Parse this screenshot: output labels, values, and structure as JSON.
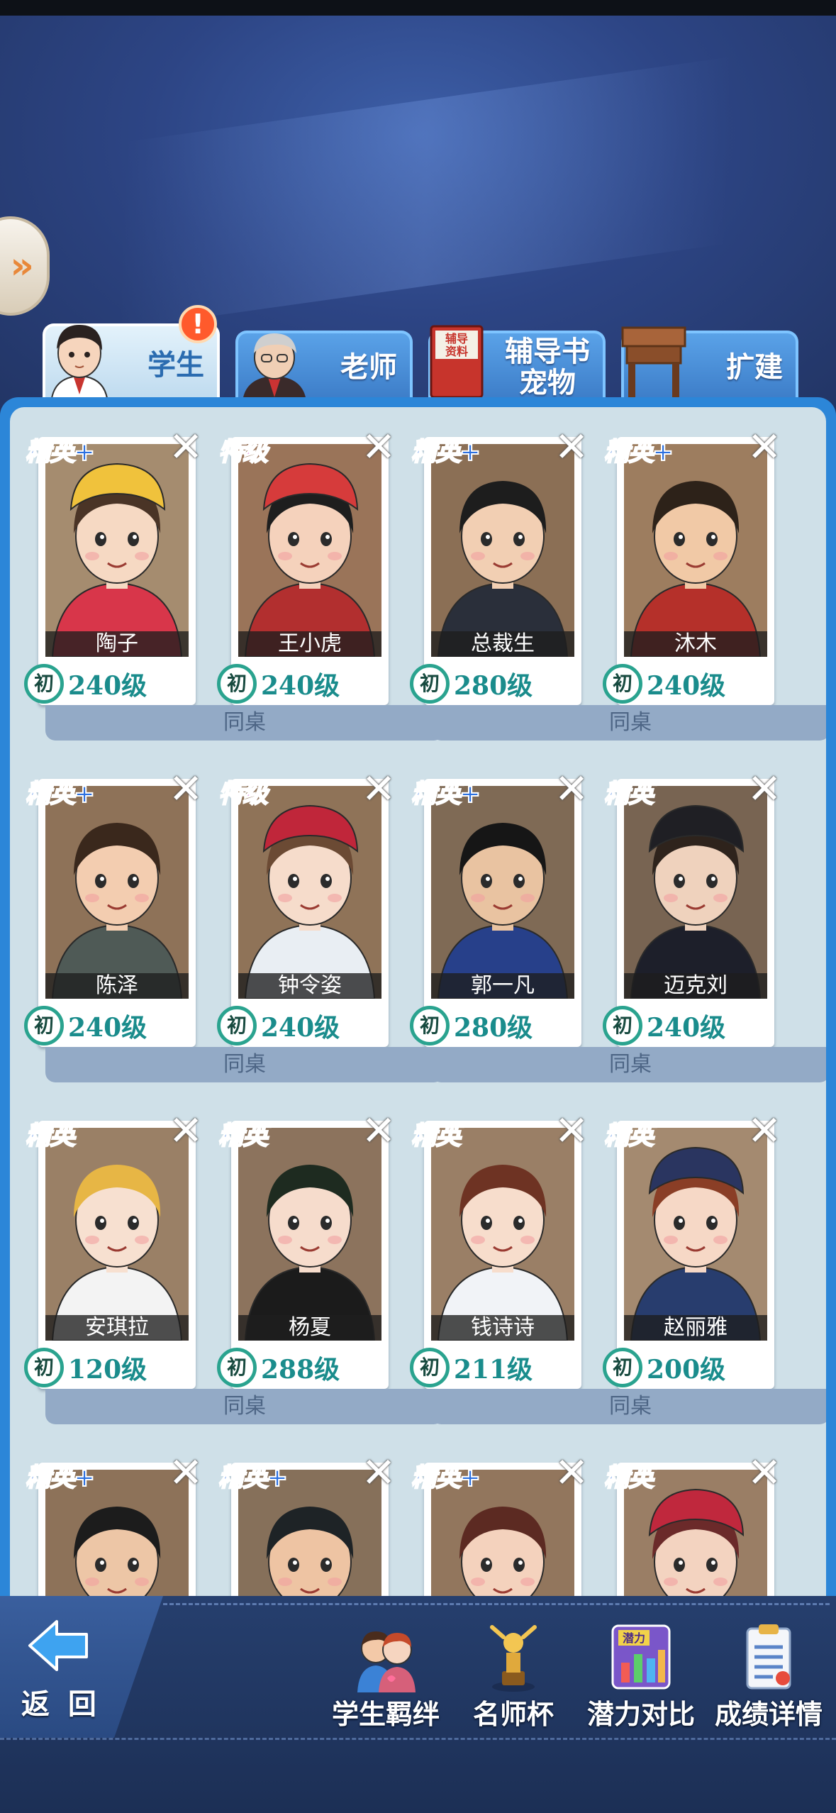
{
  "side_button": {
    "glyph": "»"
  },
  "tabs": [
    {
      "label": "学生",
      "label2": "",
      "active": true,
      "badge": "!"
    },
    {
      "label": "老师",
      "label2": "",
      "active": false
    },
    {
      "label": "辅导书",
      "label2": "宠物",
      "active": false,
      "book_text": "辅导\n资料"
    },
    {
      "label": "扩建",
      "label2": "",
      "active": false
    }
  ],
  "book_text": "辅导资料",
  "cards": [
    {
      "rank": "精英+",
      "rank_type": "elite",
      "name": "陶子",
      "stage": "初",
      "level": "240级",
      "bg": "#a58c6f",
      "skin": "#f6d9c3",
      "hair": "#4a3426",
      "hat": "#f0c23c",
      "shirt": "#d8364a"
    },
    {
      "rank": "特级",
      "rank_type": "special",
      "name": "王小虎",
      "stage": "初",
      "level": "240级",
      "bg": "#9a7459",
      "skin": "#f5d2bc",
      "hair": "#1e1e1e",
      "hat": "#d63b3b",
      "shirt": "#b22f2f"
    },
    {
      "rank": "精英+",
      "rank_type": "elite",
      "name": "总裁生",
      "stage": "初",
      "level": "280级",
      "bg": "#8b6f55",
      "skin": "#f2cfb3",
      "hair": "#1d1d1d",
      "hat": "",
      "shirt": "#2a2f3a"
    },
    {
      "rank": "精英+",
      "rank_type": "elite",
      "name": "沐木",
      "stage": "初",
      "level": "240级",
      "bg": "#9d7d5f",
      "skin": "#f1c9a6",
      "hair": "#2d2219",
      "hat": "",
      "shirt": "#b5302a"
    },
    {
      "rank": "精英+",
      "rank_type": "elite",
      "name": "陈泽",
      "stage": "初",
      "level": "240级",
      "bg": "#8e7258",
      "skin": "#f3cdb0",
      "hair": "#3a281c",
      "hat": "",
      "shirt": "#4f5a56"
    },
    {
      "rank": "特级",
      "rank_type": "special",
      "name": "钟令姿",
      "stage": "初",
      "level": "240级",
      "bg": "#8f7358",
      "skin": "#f6dccb",
      "hair": "#6b4a34",
      "hat": "#c0263a",
      "shirt": "#e9eef3"
    },
    {
      "rank": "精英+",
      "rank_type": "elite",
      "name": "郭一凡",
      "stage": "初",
      "level": "280级",
      "bg": "#7f6a55",
      "skin": "#e9c3a1",
      "hair": "#161616",
      "hat": "",
      "shirt": "#27408a"
    },
    {
      "rank": "精英",
      "rank_type": "elite",
      "name": "迈克刘",
      "stage": "初",
      "level": "240级",
      "bg": "#786452",
      "skin": "#efd2bd",
      "hair": "#2e231c",
      "hat": "#1f1f24",
      "shirt": "#1d1f2a"
    },
    {
      "rank": "精英",
      "rank_type": "elite",
      "name": "安琪拉",
      "stage": "初",
      "level": "120级",
      "bg": "#9a8066",
      "skin": "#f7e0d0",
      "hair": "#e7b645",
      "hat": "",
      "shirt": "#f3f3f3"
    },
    {
      "rank": "精英",
      "rank_type": "elite",
      "name": "杨夏",
      "stage": "初",
      "level": "288级",
      "bg": "#8c735d",
      "skin": "#f6dccc",
      "hair": "#1e2b20",
      "hat": "",
      "shirt": "#1b1b1b"
    },
    {
      "rank": "精英",
      "rank_type": "elite",
      "name": "钱诗诗",
      "stage": "初",
      "level": "211级",
      "bg": "#9a7f66",
      "skin": "#f7ddcc",
      "hair": "#6e3323",
      "hat": "",
      "shirt": "#f1f3f7"
    },
    {
      "rank": "精英",
      "rank_type": "elite",
      "name": "赵丽雅",
      "stage": "初",
      "level": "200级",
      "bg": "#a48a70",
      "skin": "#f6d8c6",
      "hair": "#8a3e26",
      "hat": "#2a3560",
      "shirt": "#283d6e"
    },
    {
      "rank": "精英+",
      "rank_type": "elite",
      "name": "",
      "stage": "",
      "level": "",
      "bg": "#8d7259",
      "skin": "#edc6a6",
      "hair": "#1c1c1c",
      "hat": "",
      "shirt": "#3a3a3a"
    },
    {
      "rank": "精英+",
      "rank_type": "elite",
      "name": "",
      "stage": "",
      "level": "",
      "bg": "#86705a",
      "skin": "#eec4a3",
      "hair": "#1e2326",
      "hat": "",
      "shirt": "#3a3a3a"
    },
    {
      "rank": "精英+",
      "rank_type": "elite",
      "name": "",
      "stage": "",
      "level": "",
      "bg": "#92765d",
      "skin": "#f4d2bd",
      "hair": "#5c2a22",
      "hat": "",
      "shirt": "#3a3a3a"
    },
    {
      "rank": "精英",
      "rank_type": "elite",
      "name": "",
      "stage": "",
      "level": "",
      "bg": "#9a7e65",
      "skin": "#f3d3c0",
      "hair": "#6b2a2a",
      "hat": "#c0283d",
      "shirt": "#3a3a3a"
    }
  ],
  "desk_label": "同桌",
  "bottom_nav": {
    "back_label": "返 回",
    "items": [
      {
        "label": "学生羁绊",
        "icon": "students-bond-icon"
      },
      {
        "label": "名师杯",
        "icon": "trophy-icon"
      },
      {
        "label": "潜力对比",
        "icon": "potential-chart-icon",
        "icon_text": "潜力"
      },
      {
        "label": "成绩详情",
        "icon": "report-clipboard-icon"
      }
    ]
  }
}
